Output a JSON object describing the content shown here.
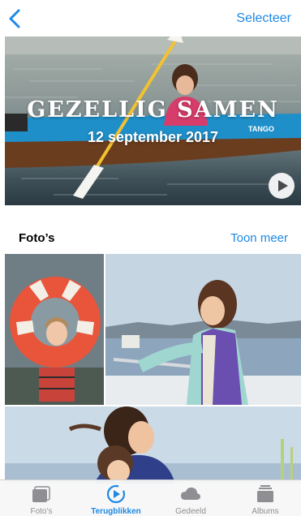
{
  "navbar": {
    "back_icon": "chevron-left-icon",
    "select_label": "Selecteer",
    "accent_color": "#1e88e5"
  },
  "hero": {
    "title": "GEZELLIG SAMEN",
    "date": "12 september 2017",
    "play_icon": "play-icon"
  },
  "section": {
    "title": "Foto’s",
    "show_more_label": "Toon meer"
  },
  "photos": [
    {
      "description_icon": "photo-thumbnail"
    },
    {
      "description_icon": "photo-thumbnail"
    },
    {
      "description_icon": "photo-thumbnail"
    }
  ],
  "tabbar": {
    "tabs": [
      {
        "label": "Foto’s",
        "icon": "photos-stack-icon",
        "active": false
      },
      {
        "label": "Terugblikken",
        "icon": "memories-play-icon",
        "active": true
      },
      {
        "label": "Gedeeld",
        "icon": "cloud-icon",
        "active": false
      },
      {
        "label": "Albums",
        "icon": "albums-icon",
        "active": false
      }
    ],
    "active_color": "#1e88e5",
    "inactive_color": "#8e8e93"
  }
}
